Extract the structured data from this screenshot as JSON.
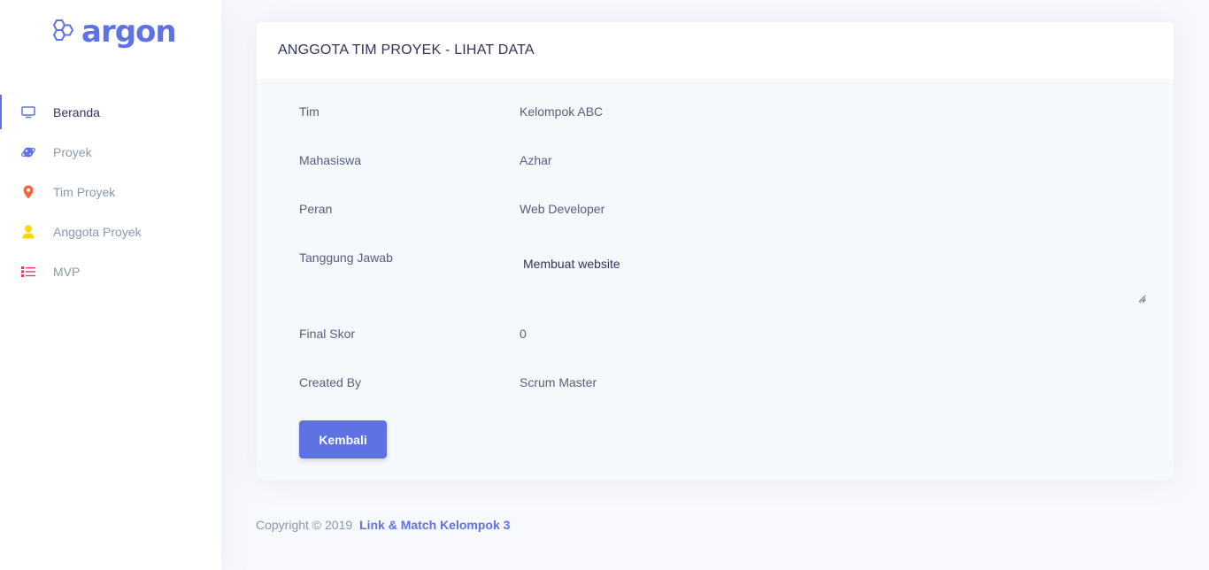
{
  "brand": {
    "name": "argon",
    "icon": "hexagon-logo-icon",
    "color": "#5e72e4"
  },
  "sidebar": {
    "items": [
      {
        "label": "Beranda",
        "icon": "tv-icon",
        "color": "#5e72e4",
        "active": true
      },
      {
        "label": "Proyek",
        "icon": "planet-icon",
        "color": "#5e72e4",
        "active": false
      },
      {
        "label": "Tim Proyek",
        "icon": "pin-icon",
        "color": "#fb6340",
        "active": false
      },
      {
        "label": "Anggota Proyek",
        "icon": "user-icon",
        "color": "#ffd600",
        "active": false
      },
      {
        "label": "MVP",
        "icon": "list-icon",
        "color": "#f5365c",
        "active": false
      }
    ]
  },
  "card": {
    "title": "ANGGOTA TIM PROYEK - LIHAT DATA",
    "fields": [
      {
        "label": "Tim",
        "value": "Kelompok ABC"
      },
      {
        "label": "Mahasiswa",
        "value": "Azhar"
      },
      {
        "label": "Peran",
        "value": "Web Developer"
      },
      {
        "label": "Tanggung Jawab",
        "value": "Membuat website"
      },
      {
        "label": "Final Skor",
        "value": "0"
      },
      {
        "label": "Created By",
        "value": "Scrum Master"
      }
    ],
    "back_button": "Kembali"
  },
  "footer": {
    "copyright": "Copyright © 2019",
    "link": "Link & Match Kelompok 3"
  }
}
